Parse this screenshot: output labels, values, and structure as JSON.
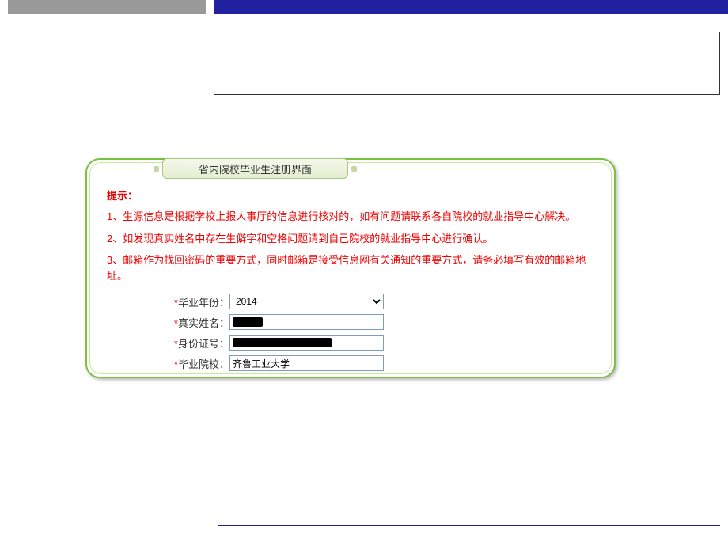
{
  "panel": {
    "title": "省内院校毕业生注册界面"
  },
  "hints": {
    "title": "提示：",
    "line1": "1、生源信息是根据学校上报人事厅的信息进行核对的，如有问题请联系各自院校的就业指导中心解决。",
    "line2": "2、如发现真实姓名中存在生僻字和空格问题请到自己院校的就业指导中心进行确认。",
    "line3": "3、邮箱作为找回密码的重要方式，同时邮箱是接受信息网有关通知的重要方式，请务必填写有效的邮箱地址。"
  },
  "form": {
    "year_label": "毕业年份：",
    "year_value": "2014",
    "name_label": "真实姓名：",
    "name_value": "",
    "id_label": "身份证号：",
    "id_value": "",
    "school_label": "毕业院校：",
    "school_value": "齐鲁工业大学",
    "asterisk": "*"
  }
}
